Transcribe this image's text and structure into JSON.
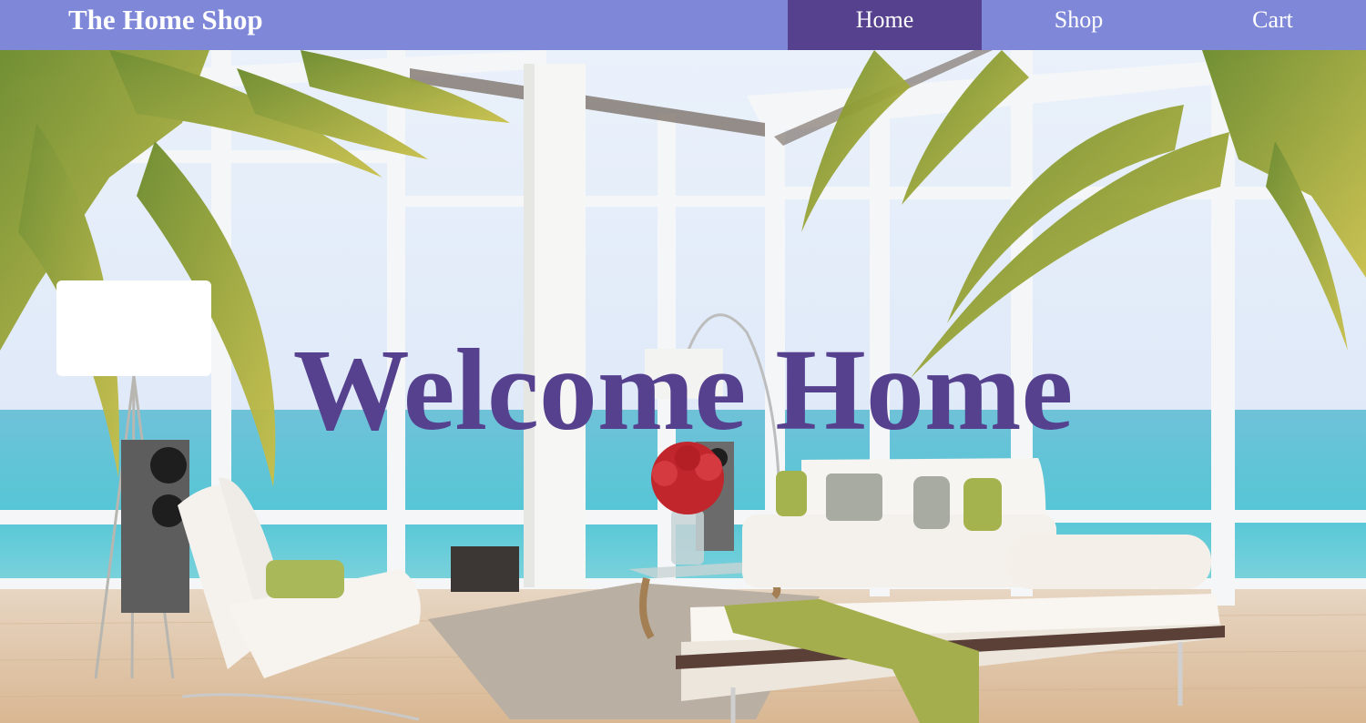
{
  "navbar": {
    "brand": "The Home Shop",
    "links": [
      {
        "label": "Home",
        "active": true
      },
      {
        "label": "Shop",
        "active": false
      },
      {
        "label": "Cart",
        "active": false
      }
    ]
  },
  "hero": {
    "title": "Welcome Home",
    "background": "beach-house-living-room-photo"
  },
  "colors": {
    "nav_bg": "#7f87d8",
    "nav_active": "#56418f",
    "title": "#56418f"
  }
}
